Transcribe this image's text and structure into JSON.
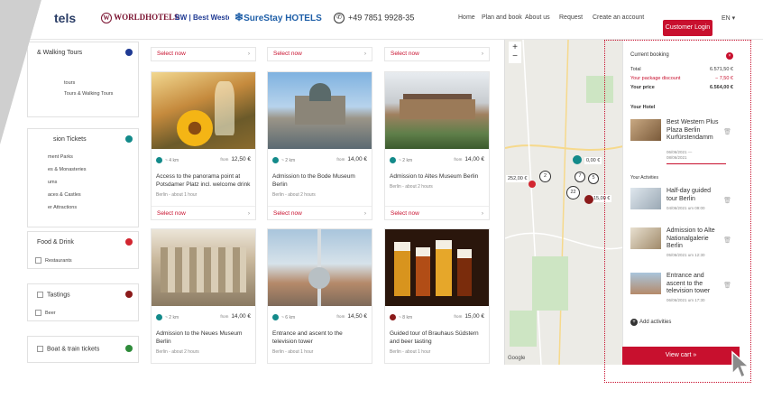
{
  "header": {
    "brand_partial": "tels",
    "logos": [
      "WORLDHOTELS",
      "BW | Best Western Hotels & Resorts",
      "SureStay HOTELS"
    ],
    "phone": "+49 7851 9928-35",
    "nav": [
      "Home",
      "Plan and book",
      "About us",
      "Request",
      "Create an account"
    ],
    "login": "Customer Login",
    "lang": "EN ▾"
  },
  "sidebar": {
    "groups": [
      {
        "title": "& Walking Tours",
        "color": "#1f3a93",
        "items": [
          "tours",
          "Tours & Walking Tours"
        ]
      },
      {
        "title": "sion Tickets",
        "color": "#138a8a",
        "items": [
          "ment Parks",
          "es & Monasteries",
          "ums",
          "aces & Castles",
          "er Attractions"
        ]
      },
      {
        "title": "Food & Drink",
        "color": "#d22630",
        "items": [
          "Restaurants"
        ]
      },
      {
        "title": "Tastings",
        "color": "#8b1a1a",
        "items": [
          "Beer"
        ]
      },
      {
        "title": "Boat & train tickets",
        "color": "#2e8b3a",
        "items": []
      }
    ]
  },
  "cards_top_row": [
    "Select now",
    "Select now",
    "Select now"
  ],
  "cards": [
    {
      "title": "Access to the panorama point at Potsdamer Platz incl. welcome drink",
      "sub": "Berlin - about 1 hour",
      "dist": "~ 4 km",
      "from": "from",
      "price": "12,50 €",
      "color": "#138a8a",
      "select": "Select now"
    },
    {
      "title": "Admission to the Bode Museum Berlin",
      "sub": "Berlin - about 2 hours",
      "dist": "~ 2 km",
      "from": "from",
      "price": "14,00 €",
      "color": "#138a8a",
      "select": "Select now"
    },
    {
      "title": "Admission to Altes Museum Berlin",
      "sub": "Berlin - about 2 hours",
      "dist": "~ 2 km",
      "from": "from",
      "price": "14,00 €",
      "color": "#138a8a",
      "select": "Select now"
    },
    {
      "title": "Admission to the Neues Museum Berlin",
      "sub": "Berlin - about 2 hours",
      "dist": "~ 2 km",
      "from": "from",
      "price": "14,00 €",
      "color": "#138a8a",
      "select": ""
    },
    {
      "title": "Entrance and ascent to the television tower",
      "sub": "Berlin - about 1 hour",
      "dist": "~ 6 km",
      "from": "from",
      "price": "14,50 €",
      "color": "#138a8a",
      "select": ""
    },
    {
      "title": "Guided tour of Brauhaus Südstern and beer tasting",
      "sub": "Berlin - about 1 hour",
      "dist": "~ 8 km",
      "from": "from",
      "price": "15,00 €",
      "color": "#8b1a1a",
      "select": ""
    }
  ],
  "map": {
    "zoom_in": "+",
    "zoom_out": "−",
    "price_labels": [
      "252,00 €",
      "0,00 €",
      "15,00 €"
    ],
    "clusters": [
      "2",
      "22",
      "7",
      "5"
    ],
    "google": "Google"
  },
  "booking": {
    "current_label": "Current booking",
    "badge": "×",
    "total_label": "Total",
    "total_value": "6.571,50 €",
    "discount_label": "Your package discount",
    "discount_value": "− 7,50 €",
    "price_label": "Your price",
    "price_value": "6.564,00 €",
    "hotel_heading": "Your Hotel",
    "hotel_name": "Best Western Plus Plaza Berlin Kurfürstendamm",
    "hotel_dates": "06/06/2021 —",
    "hotel_dates2": "08/06/2021",
    "activities_heading": "Your Activities",
    "activities": [
      {
        "name": "Half-day guided tour Berlin",
        "date": "04/06/2021 um 09:00"
      },
      {
        "name": "Admission to Alte Nationalgalerie Berlin",
        "date": "05/06/2021 um 12:30"
      },
      {
        "name": "Entrance and ascent to the television tower",
        "date": "06/06/2021 um 17:30"
      }
    ],
    "add": "Add activities",
    "view_cart": "View cart »"
  }
}
